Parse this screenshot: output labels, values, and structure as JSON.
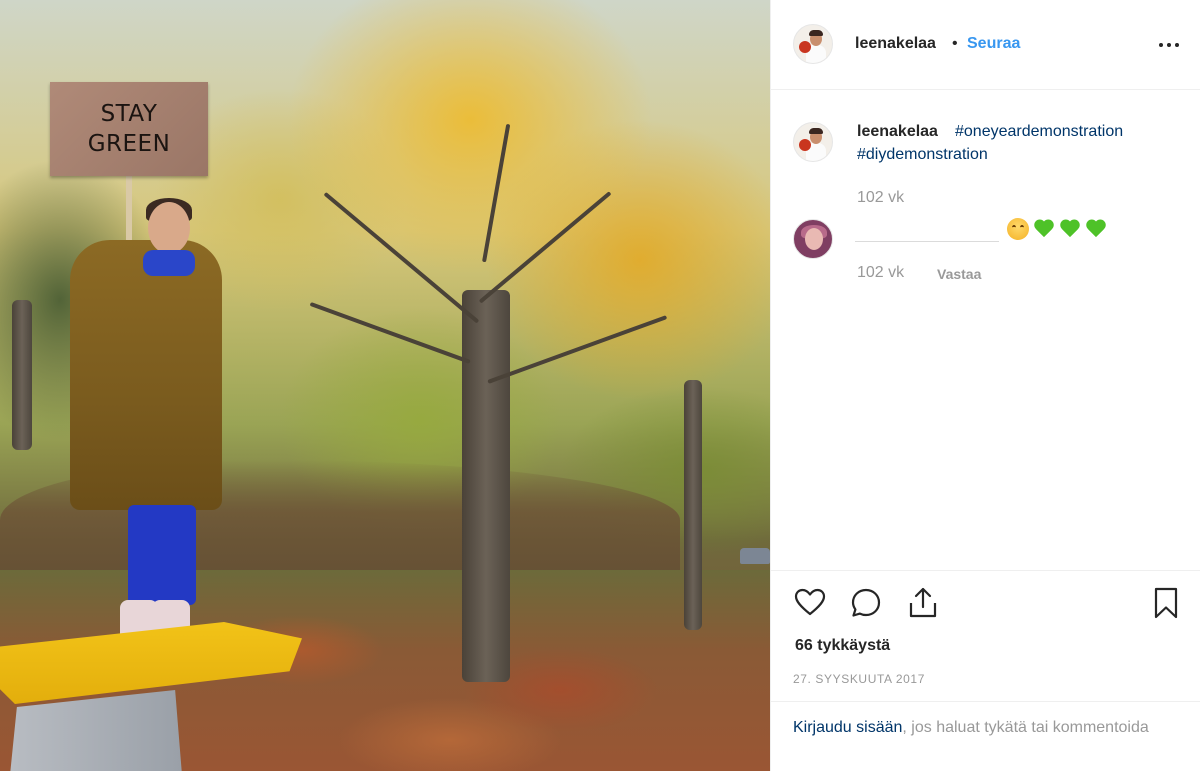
{
  "photo": {
    "sign_line1": "STAY",
    "sign_line2": "GREEN"
  },
  "header": {
    "username": "leenakelaa",
    "separator": "•",
    "follow_label": "Seuraa",
    "more_icon": "more-horizontal-icon"
  },
  "caption": {
    "username": "leenakelaa",
    "hashtags": [
      "#oneyeardemonstration",
      "#diydemonstration"
    ],
    "time": "102 vk"
  },
  "comment": {
    "emojis": [
      "smiling-face",
      "green-heart",
      "green-heart",
      "green-heart"
    ],
    "time": "102 vk",
    "reply_label": "Vastaa"
  },
  "actions": {
    "icons": [
      "heart-icon",
      "comment-icon",
      "share-icon",
      "bookmark-icon"
    ],
    "likes": "66 tykkäystä",
    "date": "27. SYYSKUUTA 2017"
  },
  "login": {
    "link": "Kirjaudu sisään",
    "text": ", jos haluat tykätä tai kommentoida"
  },
  "colors": {
    "link_blue": "#3897f0",
    "hashtag_navy": "#003569",
    "muted_gray": "#999999",
    "heart_green": "#4ec228"
  }
}
